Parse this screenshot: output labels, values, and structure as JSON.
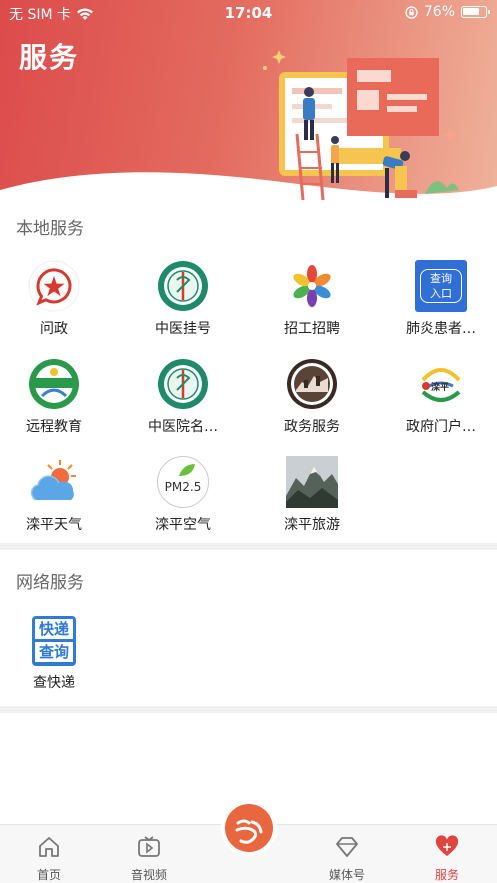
{
  "status_bar": {
    "carrier": "无 SIM 卡",
    "time": "17:04",
    "battery": "76%",
    "battery_level": 0.76
  },
  "header": {
    "title": "服务"
  },
  "local_services": {
    "title": "本地服务",
    "items": [
      {
        "label": "问政",
        "icon": "wenzheng-icon"
      },
      {
        "label": "中医挂号",
        "icon": "tcm-hospital-logo-icon"
      },
      {
        "label": "招工招聘",
        "icon": "recruitment-icon"
      },
      {
        "label": "肺炎患者…",
        "icon": "query-entry-icon",
        "icon_text_1": "查询",
        "icon_text_2": "入口"
      },
      {
        "label": "远程教育",
        "icon": "remote-education-icon"
      },
      {
        "label": "中医院名…",
        "icon": "tcm-hospital-logo-icon"
      },
      {
        "label": "政务服务",
        "icon": "great-wall-seal-icon"
      },
      {
        "label": "政府门户…",
        "icon": "luanping-logo-icon",
        "icon_text_1": "滦平"
      },
      {
        "label": "滦平天气",
        "icon": "weather-icon"
      },
      {
        "label": "滦平空气",
        "icon": "pm25-icon",
        "icon_text_1": "PM2.5"
      },
      {
        "label": "滦平旅游",
        "icon": "mountain-photo-icon"
      }
    ]
  },
  "network_services": {
    "title": "网络服务",
    "items": [
      {
        "label": "查快递",
        "icon": "express-query-icon",
        "icon_text_1": "快递",
        "icon_text_2": "查询"
      }
    ]
  },
  "tabbar": {
    "items": [
      {
        "label": "首页",
        "icon": "home-icon"
      },
      {
        "label": "音视频",
        "icon": "video-icon"
      },
      {
        "label": "",
        "icon": "center-logo-icon"
      },
      {
        "label": "媒体号",
        "icon": "diamond-icon"
      },
      {
        "label": "服务",
        "icon": "heart-icon",
        "active": true
      }
    ]
  },
  "colors": {
    "accent": "#e0443e",
    "header_start": "#dc4b4b",
    "header_end": "#efb29b",
    "center_button": "#e8673f"
  }
}
